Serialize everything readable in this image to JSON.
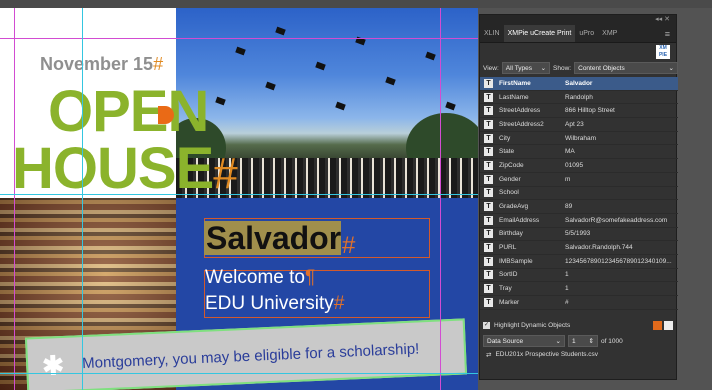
{
  "document": {
    "date_text": "November 15",
    "date_pilcrow": "#",
    "title_line1": "OPEN",
    "title_line2": "HOUSE",
    "title_pilcrow": "#",
    "name_text": "Salvador",
    "name_pilcrow": "#",
    "welcome_line1": "Welcome to",
    "welcome_pilcrow1": "¶",
    "welcome_line2": "EDU University",
    "welcome_pilcrow2": "#",
    "banner_star": "✱",
    "banner_text": "Montgomery, you may be eligible for a scholarship!"
  },
  "panel": {
    "collapse_glyph": "◂◂  ✕",
    "tabs": [
      {
        "label": "XLIN"
      },
      {
        "label": "XMPie uCreate Print"
      },
      {
        "label": "uPro"
      },
      {
        "label": "XMP"
      }
    ],
    "menu_glyph": "≡",
    "logo_text": "XM PIE",
    "view_label": "View:",
    "view_value": "All Types",
    "show_label": "Show:",
    "show_value": "Content Objects",
    "fields": [
      {
        "name": "FirstName",
        "value": "Salvador"
      },
      {
        "name": "LastName",
        "value": "Randolph"
      },
      {
        "name": "StreetAddress",
        "value": "866 Hilltop Street"
      },
      {
        "name": "StreetAddress2",
        "value": "Apt 23"
      },
      {
        "name": "City",
        "value": "Wilbraham"
      },
      {
        "name": "State",
        "value": "MA"
      },
      {
        "name": "ZipCode",
        "value": "01095"
      },
      {
        "name": "Gender",
        "value": "m"
      },
      {
        "name": "School",
        "value": ""
      },
      {
        "name": "GradeAvg",
        "value": "89"
      },
      {
        "name": "EmailAddress",
        "value": "SalvadorR@somefakeaddress.com"
      },
      {
        "name": "Birthday",
        "value": "5/5/1993"
      },
      {
        "name": "PURL",
        "value": "Salvador.Randolph.744"
      },
      {
        "name": "IMBSample",
        "value": "1234567890123456789012340109..."
      },
      {
        "name": "SortID",
        "value": "1"
      },
      {
        "name": "Tray",
        "value": "1"
      },
      {
        "name": "Marker",
        "value": "#"
      }
    ],
    "field_type_glyph": "T",
    "highlight_label": "Highlight Dynamic Objects",
    "highlight_checked": "✓",
    "datasource_label": "Data Source",
    "record_value": "1",
    "record_total": "of 1000",
    "csv_icon": "⇄",
    "csv_name": "EDU201x Prospective Students.csv"
  },
  "colors": {
    "title_green": "#8bb32c",
    "pilcrow_orange": "#e08a22",
    "panel_bg": "#323232",
    "selected_row": "#3b5b8a",
    "blue_block": "#2347a5"
  }
}
